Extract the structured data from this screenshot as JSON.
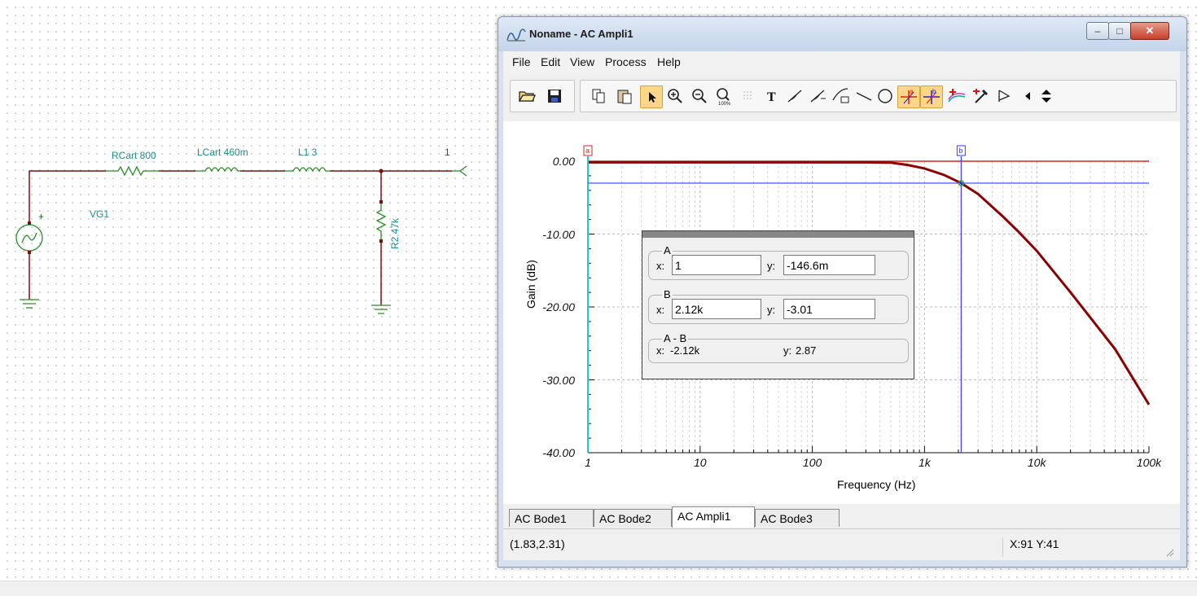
{
  "schematic": {
    "components": [
      {
        "ref": "RCart",
        "value": "800"
      },
      {
        "ref": "LCart",
        "value": "460m"
      },
      {
        "ref": "L1",
        "value": "3"
      },
      {
        "ref": "R2",
        "value": "47k"
      },
      {
        "ref": "VG1",
        "value": ""
      }
    ],
    "labels": {
      "rcart": "RCart 800",
      "lcart": "LCart 460m",
      "l1": "L1 3",
      "r2": "R2 47k",
      "vg1": "VG1",
      "vg_plus": "+",
      "node1": "1"
    }
  },
  "window": {
    "title": "Noname - AC Ampli1",
    "menu": [
      "File",
      "Edit",
      "View",
      "Process",
      "Help"
    ],
    "controls": {
      "minimize": "–",
      "maximize": "□",
      "close": "✕"
    },
    "toolbar": [
      "open-folder-icon",
      "save-icon",
      "copy-icon",
      "paste-icon",
      "pointer-icon",
      "zoom-in-icon",
      "zoom-out-icon",
      "zoom-100-icon",
      "grid-icon",
      "text-icon",
      "tangent-icon",
      "tangent-with-label-icon",
      "curve-label-icon",
      "line-icon",
      "circle-icon",
      "cursor-a-icon",
      "cursor-b-icon",
      "add-curve-icon",
      "pipette-icon",
      "flag-icon",
      "scroll-left-icon",
      "scroll-updown-icon"
    ],
    "tabs": [
      {
        "label": "AC Bode1",
        "active": false
      },
      {
        "label": "AC Bode2",
        "active": false
      },
      {
        "label": "AC Ampli1",
        "active": true
      },
      {
        "label": "AC Bode3",
        "active": false
      }
    ],
    "status": {
      "coords": "(1.83,2.31)",
      "xy": "X:91  Y:41"
    }
  },
  "chart_data": {
    "type": "line",
    "ylabel": "Gain (dB)",
    "xlabel": "Frequency (Hz)",
    "xscale": "log",
    "xlim": [
      1,
      100000
    ],
    "ylim": [
      -40,
      0
    ],
    "x_ticks": [
      "1",
      "10",
      "100",
      "1k",
      "10k",
      "100k"
    ],
    "y_ticks": [
      "0.00",
      "-10.00",
      "-20.00",
      "-30.00",
      "-40.00"
    ],
    "grid": true,
    "series": [
      {
        "color": "#8b0000",
        "x": [
          1,
          10,
          100,
          300,
          500,
          700,
          1000,
          1500,
          2120,
          3000,
          5000,
          7000,
          10000,
          20000,
          50000,
          100000
        ],
        "y": [
          -0.15,
          -0.15,
          -0.15,
          -0.15,
          -0.2,
          -0.5,
          -1.0,
          -1.9,
          -3.01,
          -4.5,
          -7.6,
          -9.8,
          -12.3,
          -18.0,
          -25.8,
          -33.4
        ]
      }
    ],
    "cursor_a": {
      "x": 1,
      "y": -0.1466
    },
    "cursor_b": {
      "x": 2120,
      "y": -3.01
    },
    "reference_line": {
      "y": 0,
      "color": "#e02020"
    },
    "cursor_markers": {
      "a": "a",
      "b": "b"
    }
  },
  "cursor_box": {
    "a": {
      "label": "A",
      "x_label": "x:",
      "x": "1",
      "y_label": "y:",
      "y": "-146.6m"
    },
    "b": {
      "label": "B",
      "x_label": "x:",
      "x": "2.12k",
      "y_label": "y:",
      "y": "-3.01"
    },
    "diff": {
      "label": "A - B",
      "x_label": "x:",
      "x": "-2.12k",
      "y_label": "y:",
      "y": "2.87"
    }
  }
}
